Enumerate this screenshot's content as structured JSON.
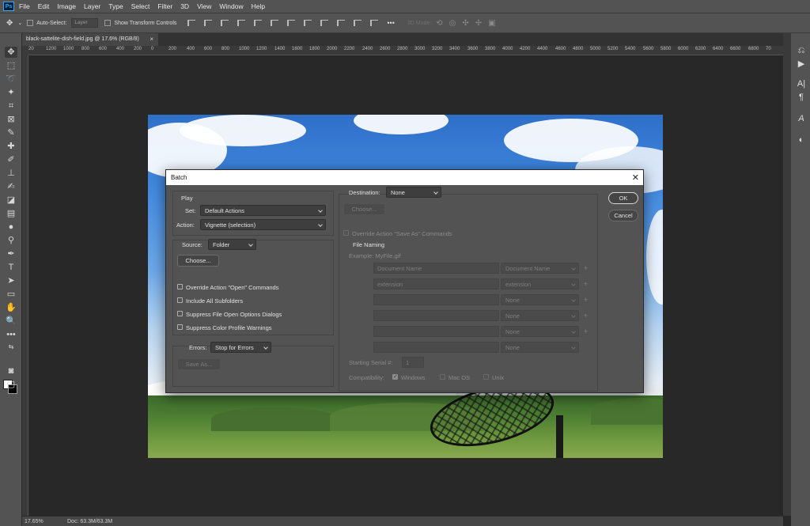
{
  "menubar": {
    "logo": "Ps",
    "items": [
      "File",
      "Edit",
      "Image",
      "Layer",
      "Type",
      "Select",
      "Filter",
      "3D",
      "View",
      "Window",
      "Help"
    ]
  },
  "options": {
    "auto_select": "Auto-Select:",
    "layer": "Layer",
    "show_transform": "Show Transform Controls",
    "more": "•••",
    "mode_3d": "3D Mode:"
  },
  "document": {
    "tab_title": "black-sattelite-dish-field.jpg @ 17.6% (RGB/8)",
    "close": "×"
  },
  "ruler_labels": [
    "20",
    "1200",
    "1000",
    "800",
    "600",
    "400",
    "200",
    "0",
    "200",
    "400",
    "600",
    "800",
    "1000",
    "1200",
    "1400",
    "1600",
    "1800",
    "2000",
    "2200",
    "2400",
    "2600",
    "2800",
    "3000",
    "3200",
    "3400",
    "3600",
    "3800",
    "4000",
    "4200",
    "4400",
    "4600",
    "4800",
    "5000",
    "5200",
    "5400",
    "5600",
    "5800",
    "6000",
    "6200",
    "6400",
    "6600",
    "6800",
    "70"
  ],
  "status": {
    "zoom": "17.65%",
    "doc": "Doc: 63.3M/63.3M"
  },
  "dialog": {
    "title": "Batch",
    "close": "✕",
    "play": {
      "heading": "Play",
      "set_label": "Set:",
      "set_value": "Default Actions",
      "action_label": "Action:",
      "action_value": "Vignette (selection)"
    },
    "source": {
      "label": "Source:",
      "value": "Folder",
      "choose": "Choose...",
      "checks": [
        "Override Action \"Open\" Commands",
        "Include All Subfolders",
        "Suppress File Open Options Dialogs",
        "Suppress Color Profile Warnings"
      ]
    },
    "errors": {
      "label": "Errors:",
      "value": "Stop for Errors",
      "save_as": "Save As..."
    },
    "destination": {
      "label": "Destination:",
      "value": "None",
      "choose": "Choose...",
      "override": "Override Action \"Save As\" Commands",
      "file_naming": "File Naming",
      "example": "Example: MyFile.gif",
      "naming_rows": [
        {
          "field": "Document Name",
          "select": "Document Name"
        },
        {
          "field": "extension",
          "select": "extension"
        },
        {
          "field": "",
          "select": "None"
        },
        {
          "field": "",
          "select": "None"
        },
        {
          "field": "",
          "select": "None"
        },
        {
          "field": "",
          "select": "None"
        }
      ],
      "plus": "+",
      "serial_label": "Starting Serial #:",
      "serial_value": "1",
      "compat_label": "Compatibility:",
      "compat_windows": "Windows",
      "compat_mac": "Mac OS",
      "compat_unix": "Unix"
    },
    "ok": "OK",
    "cancel": "Cancel"
  }
}
